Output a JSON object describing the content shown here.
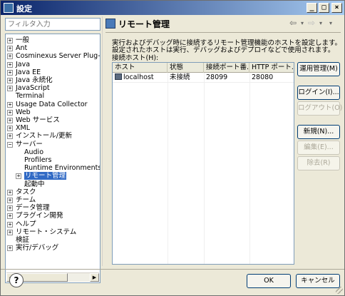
{
  "window": {
    "title": "設定",
    "controls": [
      "_",
      "□",
      "×"
    ]
  },
  "filter": {
    "placeholder": "フィルタ入力",
    "value": ""
  },
  "tree": [
    {
      "label": "一般",
      "expander": "+",
      "level": 0
    },
    {
      "label": "Ant",
      "expander": "+",
      "level": 0
    },
    {
      "label": "Cosminexus Server Plug-in",
      "expander": "+",
      "level": 0
    },
    {
      "label": "Java",
      "expander": "+",
      "level": 0
    },
    {
      "label": "Java EE",
      "expander": "+",
      "level": 0
    },
    {
      "label": "Java 永続化",
      "expander": "+",
      "level": 0
    },
    {
      "label": "JavaScript",
      "expander": "+",
      "level": 0
    },
    {
      "label": "Terminal",
      "expander": "",
      "level": 0
    },
    {
      "label": "Usage Data Collector",
      "expander": "+",
      "level": 0
    },
    {
      "label": "Web",
      "expander": "+",
      "level": 0
    },
    {
      "label": "Web サービス",
      "expander": "+",
      "level": 0
    },
    {
      "label": "XML",
      "expander": "+",
      "level": 0
    },
    {
      "label": "インストール/更新",
      "expander": "+",
      "level": 0
    },
    {
      "label": "サーバー",
      "expander": "−",
      "level": 0
    },
    {
      "label": "Audio",
      "expander": "",
      "level": 1
    },
    {
      "label": "Profilers",
      "expander": "",
      "level": 1
    },
    {
      "label": "Runtime Environments",
      "expander": "",
      "level": 1
    },
    {
      "label": "リモート管理",
      "expander": "+",
      "level": 1,
      "selected": true
    },
    {
      "label": "起動中",
      "expander": "",
      "level": 1
    },
    {
      "label": "タスク",
      "expander": "+",
      "level": 0
    },
    {
      "label": "チーム",
      "expander": "+",
      "level": 0
    },
    {
      "label": "データ管理",
      "expander": "+",
      "level": 0
    },
    {
      "label": "プラグイン開発",
      "expander": "+",
      "level": 0
    },
    {
      "label": "ヘルプ",
      "expander": "+",
      "level": 0
    },
    {
      "label": "リモート・システム",
      "expander": "+",
      "level": 0
    },
    {
      "label": "検証",
      "expander": "",
      "level": 0
    },
    {
      "label": "実行/デバッグ",
      "expander": "+",
      "level": 0
    }
  ],
  "page": {
    "title": "リモート管理",
    "nav_back": "⇦",
    "nav_forward": "⇨",
    "nav_menu": "▾",
    "description_line1": "実行およびデバッグ時に接続するリモート管理機能のホストを設定します。",
    "description_line2": "設定されたホストは実行、デバッグおよびデプロイなどで使用されます。",
    "hosts_label": "接続ホスト(H):"
  },
  "table": {
    "columns": [
      "ホスト",
      "状態",
      "接続ポート番...",
      "HTTP ポート..."
    ],
    "rows": [
      {
        "host": "localhost",
        "status": "未接続",
        "port": "28099",
        "http_port": "28080"
      }
    ]
  },
  "buttons": {
    "operation": "運用管理(M)",
    "login": "ログイン(I)...",
    "logout": "ログアウト(O)",
    "new": "新規(N)...",
    "edit": "編集(E)...",
    "remove": "除去(R)",
    "ok": "OK",
    "cancel": "キャンセル"
  },
  "help": {
    "label": "?"
  }
}
